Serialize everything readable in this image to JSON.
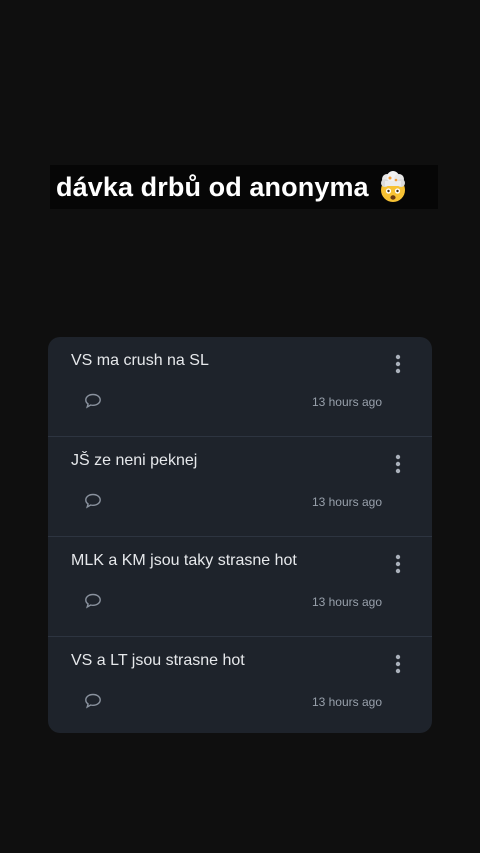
{
  "headline": {
    "text": "dávka drbů od anonyma",
    "emoji_icon": "exploding-head-emoji"
  },
  "posts": [
    {
      "text": "VS ma crush na SL",
      "time": "13 hours ago"
    },
    {
      "text": "JŠ ze neni peknej",
      "time": "13 hours ago"
    },
    {
      "text": "MLK a KM jsou taky strasne hot",
      "time": "13 hours ago"
    },
    {
      "text": "VS a LT jsou strasne hot",
      "time": "13 hours ago"
    }
  ],
  "colors": {
    "background": "#0f0f0f",
    "card": "#1e232b",
    "text": "#e6e8eb",
    "muted": "#98a0ab"
  }
}
